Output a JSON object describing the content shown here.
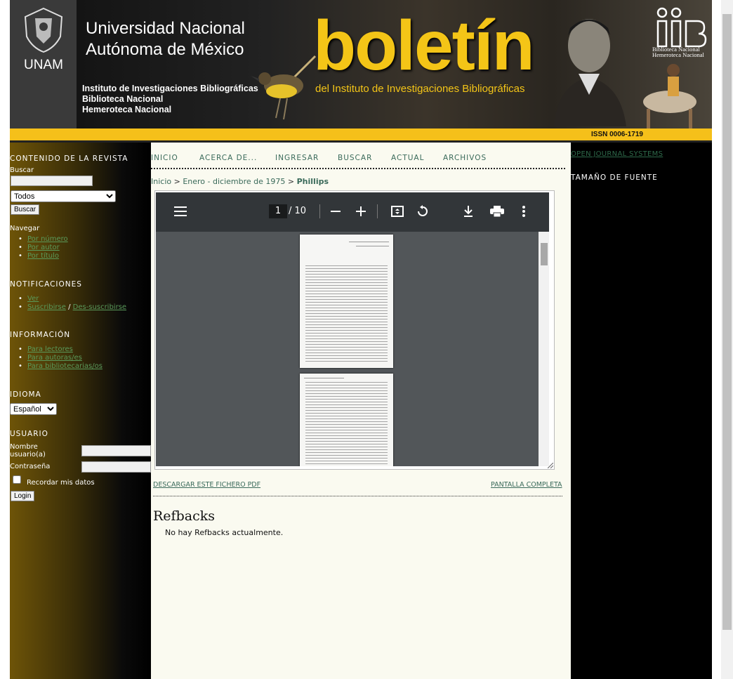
{
  "header": {
    "university_line1": "Universidad Nacional",
    "university_line2": "Autónoma de México",
    "unam": "UNAM",
    "institute_line1": "Instituto de Investigaciones Bibliográficas",
    "institute_line2": "Biblioteca Nacional",
    "institute_line3": "Hemeroteca Nacional",
    "title": "boletín",
    "subtitle": "del Instituto de Investigaciones Bibliográficas",
    "issn": "ISSN 0006-1719",
    "iib_line1": "Biblioteca Nacional",
    "iib_line2": "Hemeroteca Nacional"
  },
  "left": {
    "contenido_title": "CONTENIDO DE LA REVISTA",
    "buscar_label": "Buscar",
    "search_value": "",
    "scope_selected": "Todos",
    "buscar_button": "Buscar",
    "navegar_label": "Navegar",
    "nav_links": [
      "Por número",
      "Por autor",
      "Por título"
    ],
    "notificaciones_title": "NOTIFICACIONES",
    "ver": "Ver",
    "suscribirse": "Suscribirse",
    "separator": "/",
    "des_suscribirse": "Des-suscribirse",
    "informacion_title": "INFORMACIÓN",
    "info_links": [
      "Para lectores",
      "Para autoras/es",
      "Para bibliotecarias/os"
    ],
    "idioma_title": "IDIOMA",
    "language_selected": "Español",
    "usuario_title": "USUARIO",
    "username_label": "Nombre usuario(a)",
    "password_label": "Contraseña",
    "remember_label": "Recordar mis datos",
    "login_button": "Login"
  },
  "nav": {
    "items": [
      "INICIO",
      "ACERCA DE...",
      "INGRESAR",
      "BUSCAR",
      "ACTUAL",
      "ARCHIVOS"
    ]
  },
  "breadcrumb": {
    "home": "Inicio",
    "sep": ">",
    "issue": "Enero - diciembre de 1975",
    "current": "Phillips"
  },
  "viewer": {
    "page_current": "1",
    "page_total": "/ 10"
  },
  "content": {
    "download_label": "DESCARGAR ESTE FICHERO PDF",
    "fullscreen_label": "PANTALLA COMPLETA",
    "refbacks_title": "Refbacks",
    "refbacks_text": "No hay Refbacks actualmente."
  },
  "right": {
    "ojs_link": "OPEN JOURNAL SYSTEMS",
    "font_size_title": "TAMAÑO DE FUENTE"
  },
  "colors": {
    "accent_yellow": "#f5c01a",
    "link_green": "#3a6a5a",
    "content_bg": "#fafaf0"
  }
}
